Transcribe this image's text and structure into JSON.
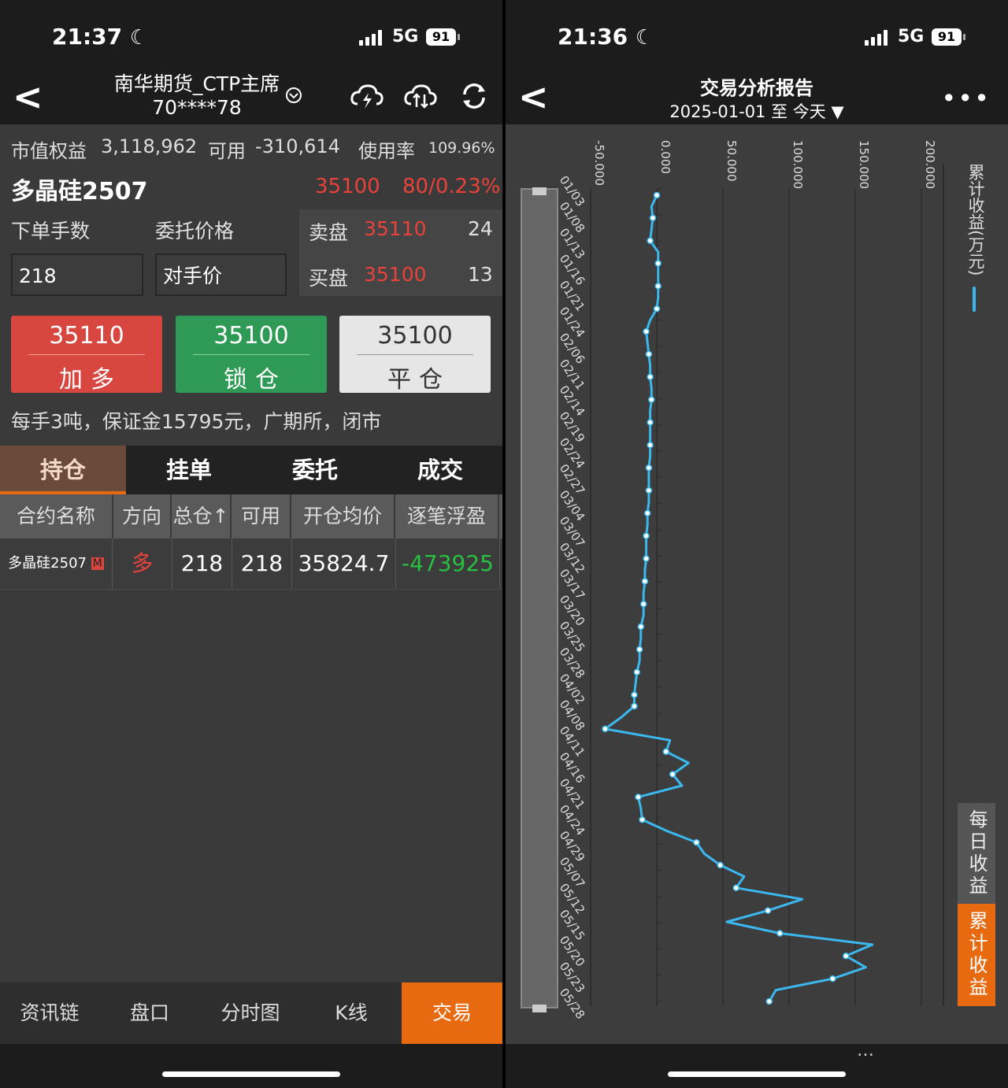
{
  "left": {
    "status": {
      "time": "21:37",
      "network": "5G",
      "battery": "91"
    },
    "nav": {
      "account_line1": "南华期货_CTP主席",
      "account_line2": "70****78"
    },
    "account": {
      "equity_label": "市值权益",
      "equity_value": "3,118,962",
      "avail_label": "可用",
      "avail_value": "-310,614",
      "usage_label": "使用率",
      "usage_value": "109.96%"
    },
    "product": {
      "name": "多晶硅2507",
      "last": "35100",
      "change": "80/0.23%"
    },
    "order": {
      "qty_label": "下单手数",
      "price_label": "委托价格",
      "qty_value": "218",
      "price_value": "对手价"
    },
    "book": {
      "ask_label": "卖盘",
      "ask_price": "35110",
      "ask_vol": "24",
      "bid_label": "买盘",
      "bid_price": "35100",
      "bid_vol": "13"
    },
    "buttons": [
      {
        "price": "35110",
        "label": "加多"
      },
      {
        "price": "35100",
        "label": "锁仓"
      },
      {
        "price": "35100",
        "label": "平仓"
      }
    ],
    "note": "每手3吨，保证金15795元，广期所，闭市",
    "tabs": [
      "持仓",
      "挂单",
      "委托",
      "成交"
    ],
    "table": {
      "headers": [
        "合约名称",
        "方向",
        "总仓",
        "可用",
        "开仓均价",
        "逐笔浮盈"
      ],
      "row": {
        "name": "多晶硅2507",
        "badge": "M",
        "dir": "多",
        "total": "218",
        "avail": "218",
        "avg": "35824.7",
        "pnl": "-473925"
      }
    },
    "bottom_nav": [
      "资讯链",
      "盘口",
      "分时图",
      "K线",
      "交易"
    ],
    "colors": {
      "up": "#e8423a",
      "down": "#27c13f",
      "accent": "#e86a10"
    }
  },
  "right": {
    "status": {
      "time": "21:36",
      "network": "5G",
      "battery": "91"
    },
    "nav": {
      "title": "交易分析报告",
      "range": "2025-01-01 至 今天"
    },
    "legend": "累计收益(万元)",
    "side_buttons": [
      "每日收益",
      "累计收益"
    ],
    "watermark": "…"
  },
  "chart_data": {
    "type": "line",
    "orientation": "rotated (dates top-to-bottom, value left-to-right)",
    "ylabel": "累计收益(万元)",
    "ylim": [
      -50,
      200
    ],
    "y_ticks": [
      "-50.000",
      "0.000",
      "50.000",
      "100.000",
      "150.000",
      "200.000"
    ],
    "x_tick_labels": [
      "01/03",
      "01/08",
      "01/13",
      "01/16",
      "01/21",
      "01/24",
      "02/06",
      "02/11",
      "02/14",
      "02/19",
      "02/24",
      "02/27",
      "03/04",
      "03/07",
      "03/12",
      "03/17",
      "03/20",
      "03/25",
      "03/28",
      "04/02",
      "04/08",
      "04/11",
      "04/16",
      "04/21",
      "04/24",
      "04/29",
      "05/07",
      "05/12",
      "05/15",
      "05/20",
      "05/23",
      "05/28"
    ],
    "series": [
      {
        "color": "#3bb8ee",
        "values": [
          0,
          -4,
          -3,
          -4,
          -5,
          1,
          1,
          1,
          1,
          1,
          0,
          -5,
          -8,
          -7,
          -6,
          -5,
          -5,
          -4,
          -4,
          -5,
          -5,
          -5,
          -5,
          -5,
          -6,
          -6,
          -6,
          -6,
          -7,
          -7,
          -8,
          -8,
          -8,
          -9,
          -9,
          -10,
          -10,
          -10,
          -12,
          -12,
          -13,
          -13,
          -15,
          -16,
          -17,
          -17,
          -27,
          -39,
          10,
          7,
          24,
          12,
          19,
          -14,
          -12,
          -11,
          8,
          30,
          36,
          48,
          66,
          60,
          110,
          84,
          53,
          93,
          163,
          143,
          158,
          133,
          90,
          85
        ]
      }
    ]
  }
}
